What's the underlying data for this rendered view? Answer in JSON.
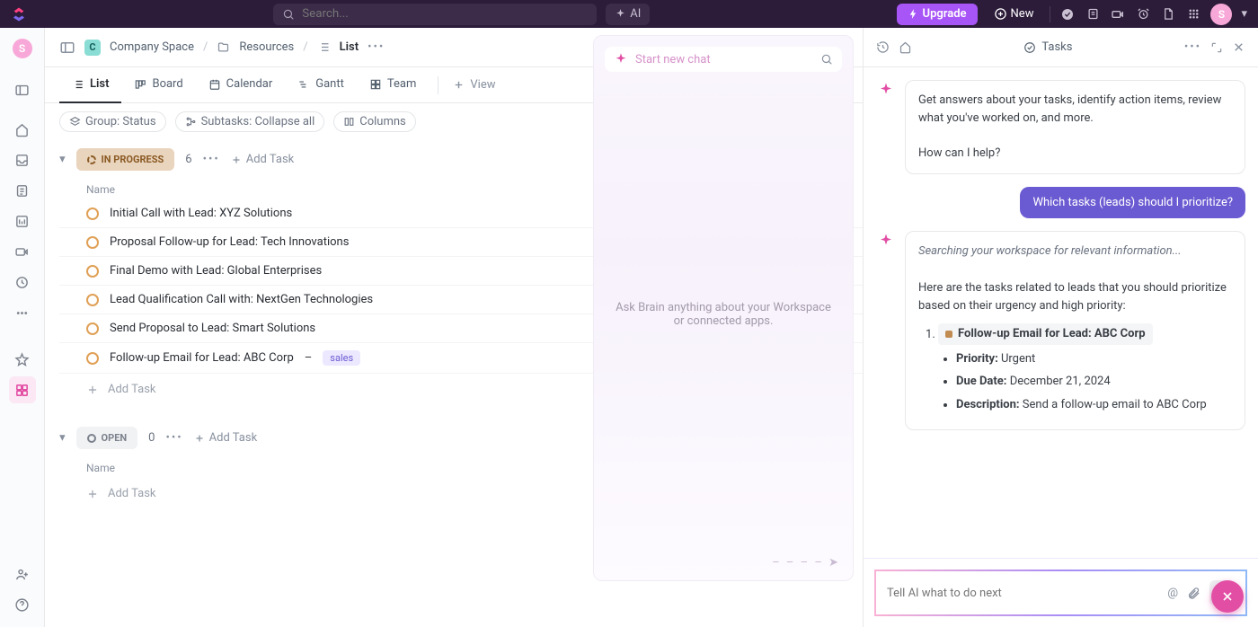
{
  "top": {
    "search_placeholder": "Search...",
    "ai_label": "AI",
    "upgrade_label": "Upgrade",
    "new_label": "New",
    "avatar_initial": "S"
  },
  "breadcrumb": {
    "space_initial": "C",
    "space_name": "Company Space",
    "folder_name": "Resources",
    "list_name": "List"
  },
  "views": [
    {
      "icon": "list",
      "label": "List",
      "active": true
    },
    {
      "icon": "board",
      "label": "Board"
    },
    {
      "icon": "calendar",
      "label": "Calendar"
    },
    {
      "icon": "gantt",
      "label": "Gantt"
    },
    {
      "icon": "team",
      "label": "Team"
    }
  ],
  "view_add": "View",
  "filters": {
    "group": "Group: Status",
    "subtasks": "Subtasks: Collapse all",
    "columns": "Columns"
  },
  "groups": [
    {
      "status": "IN PROGRESS",
      "count": 6,
      "column_header": "Name",
      "add_task": "Add Task",
      "tasks": [
        {
          "name": "Initial Call with Lead: XYZ Solutions"
        },
        {
          "name": "Proposal Follow-up for Lead: Tech Innovations"
        },
        {
          "name": "Final Demo with Lead: Global Enterprises"
        },
        {
          "name": "Lead Qualification Call with: NextGen Technologies"
        },
        {
          "name": "Send Proposal to Lead: Smart Solutions"
        },
        {
          "name": "Follow-up Email for Lead: ABC Corp",
          "tag": "sales"
        }
      ]
    },
    {
      "status": "OPEN",
      "count": 0,
      "column_header": "Name",
      "add_task": "Add Task",
      "tasks": []
    }
  ],
  "add_task_placeholder": "Add Task",
  "mid": {
    "start_new_chat": "Start new chat",
    "hint": "Ask Brain anything about your Workspace or connected apps."
  },
  "right": {
    "title": "Tasks",
    "ai_greeting": "Get answers about your tasks, identify action items, review what you've worked on, and more.",
    "ai_prompt": "How can I help?",
    "user_msg": "Which tasks (leads) should I prioritize?",
    "ai_searching": "Searching your workspace for relevant information...",
    "ai_answer_intro": "Here are the tasks related to leads that you should prioritize based on their urgency and high priority:",
    "answer_item_1": {
      "title": "Follow-up Email for Lead: ABC Corp",
      "priority_label": "Priority:",
      "priority_value": "Urgent",
      "due_label": "Due Date:",
      "due_value": "December 21, 2024",
      "desc_label": "Description:",
      "desc_value": "Send a follow-up email to ABC Corp"
    },
    "input_placeholder": "Tell AI what to do next"
  }
}
